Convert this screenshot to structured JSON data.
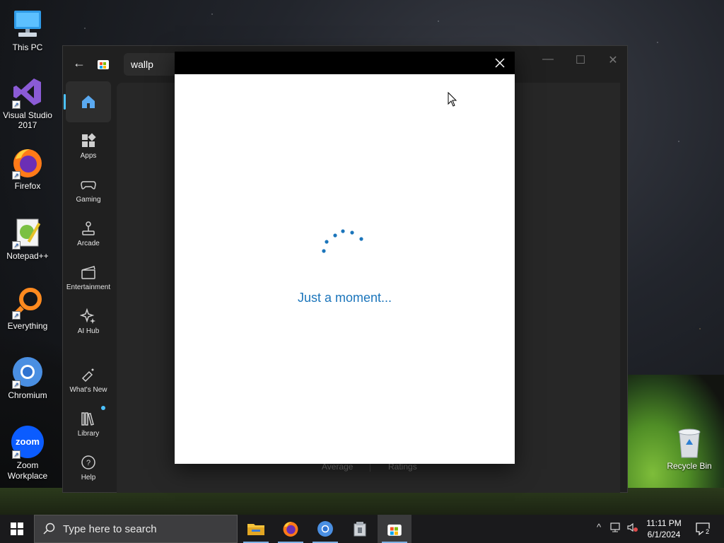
{
  "desktop": {
    "icons": [
      {
        "label": "This PC",
        "icon": "computer-icon"
      },
      {
        "label": "Visual Studio\n2017",
        "icon": "visual-studio-icon"
      },
      {
        "label": "Firefox",
        "icon": "firefox-icon"
      },
      {
        "label": "Notepad++",
        "icon": "notepad-plus-plus-icon"
      },
      {
        "label": "Everything",
        "icon": "everything-search-icon"
      },
      {
        "label": "Chromium",
        "icon": "chromium-icon"
      },
      {
        "label": "Zoom\nWorkplace",
        "icon": "zoom-icon"
      },
      {
        "label": "Recycle Bin",
        "icon": "recycle-bin-icon"
      }
    ],
    "zoom_logo_text": "zoom"
  },
  "store": {
    "search_value": "wallp",
    "nav": [
      {
        "label": "",
        "icon": "home-icon",
        "active": true
      },
      {
        "label": "Apps",
        "icon": "apps-icon"
      },
      {
        "label": "Gaming",
        "icon": "gamepad-icon"
      },
      {
        "label": "Arcade",
        "icon": "joystick-icon"
      },
      {
        "label": "Entertainment",
        "icon": "clapperboard-icon"
      },
      {
        "label": "AI Hub",
        "icon": "sparkle-icon"
      },
      {
        "label": "What's New",
        "icon": "megaphone-icon"
      },
      {
        "label": "Library",
        "icon": "library-icon",
        "badge": true
      },
      {
        "label": "Help",
        "icon": "help-icon"
      }
    ],
    "content_fragments": {
      "average": "Average",
      "ratings": "Ratings"
    },
    "accent": "#4cc2ff"
  },
  "dialog": {
    "loading_text": "Just a moment...",
    "accent": "#1b75bb"
  },
  "taskbar": {
    "search_placeholder": "Type here to search",
    "apps": [
      "file-explorer-icon",
      "firefox-icon",
      "chromium-icon",
      "package-icon",
      "microsoft-store-icon"
    ],
    "time": "11:11 PM",
    "date": "6/1/2024",
    "notification_count": "2"
  }
}
